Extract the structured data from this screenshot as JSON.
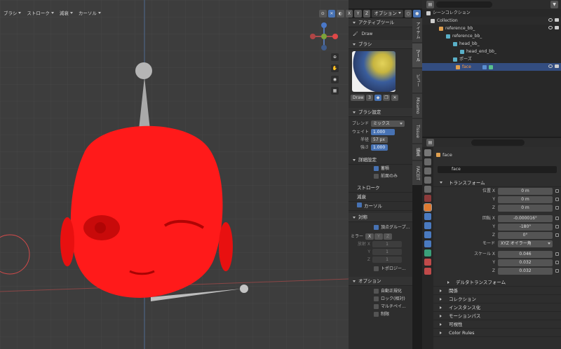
{
  "viewport_menu": [
    "ブラシ",
    "ストローク",
    "減衰",
    "カーソル"
  ],
  "options_label": "オプション",
  "side_tabs": [
    "アイテム",
    "ツール",
    "ビュー",
    "Mixamo",
    "Tissue",
    "編集",
    "FACEIT"
  ],
  "tool_panel": {
    "active_tool_header": "アクティブツール",
    "active_tool_name": "Draw",
    "brush_header": "ブラシ",
    "brush_name": "Draw",
    "brush_users": "3",
    "brush_settings_header": "ブラシ設定",
    "blend_label": "ブレンド",
    "blend_value": "ミックス",
    "weight_label": "ウェイト",
    "weight_value": "1.000",
    "radius_label": "半径",
    "radius_value": "57 px",
    "strength_label": "強さ",
    "strength_value": "1.000",
    "advanced_header": "詳細設定",
    "accumulate_label": "蓄積",
    "front_only_label": "前面のみ",
    "stroke_header": "ストローク",
    "falloff_header": "減衰",
    "cursor_header": "カーソル",
    "symmetry_header": "対称",
    "vertex_group_label": "頂点グループ...",
    "mirror_label": "ミラー",
    "axes": [
      "X",
      "Y",
      "Z"
    ],
    "radial_x_label": "放射 X",
    "radial_x_value": "1",
    "radial_y_value": "1",
    "radial_z_value": "1",
    "topology_label": "トポロジー...",
    "options_header": "オプション",
    "auto_normalize_label": "自動正規化",
    "lock_relative_label": "ロック(相対)",
    "multi_paint_label": "マルチペイ...",
    "restrict_label": "制限"
  },
  "outliner": {
    "search_placeholder": "",
    "scene_collection": "シーンコレクション",
    "items": [
      {
        "label": "Collection",
        "indent": 0
      },
      {
        "label": "reference_bb_",
        "indent": 1
      },
      {
        "label": "reference_bb_",
        "indent": 2
      },
      {
        "label": "head_bb_",
        "indent": 3
      },
      {
        "label": "head_end_bb_",
        "indent": 4
      },
      {
        "label": "ポーズ",
        "indent": 2
      },
      {
        "label": "face",
        "indent": 1
      }
    ]
  },
  "properties": {
    "object_name": "face",
    "object_field": "face",
    "transform_header": "トランスフォーム",
    "location": {
      "label": "位置 X",
      "x": "0 m",
      "y": "0 m",
      "z": "0 m"
    },
    "rotation": {
      "label": "回転 X",
      "x": "-0.000016°",
      "y": "-180°",
      "z": "0°"
    },
    "mode_label": "モード",
    "mode_value": "XYZ オイラー角",
    "scale": {
      "label": "スケール X",
      "x": "0.046",
      "y": "0.032",
      "z": "0.032"
    },
    "axis_y": "Y",
    "axis_z": "Z",
    "delta_transform": "デルタトランスフォーム",
    "sections": [
      "関係",
      "コレクション",
      "インスタンス化",
      "モーションパス",
      "可視性",
      "Color Rules"
    ]
  }
}
